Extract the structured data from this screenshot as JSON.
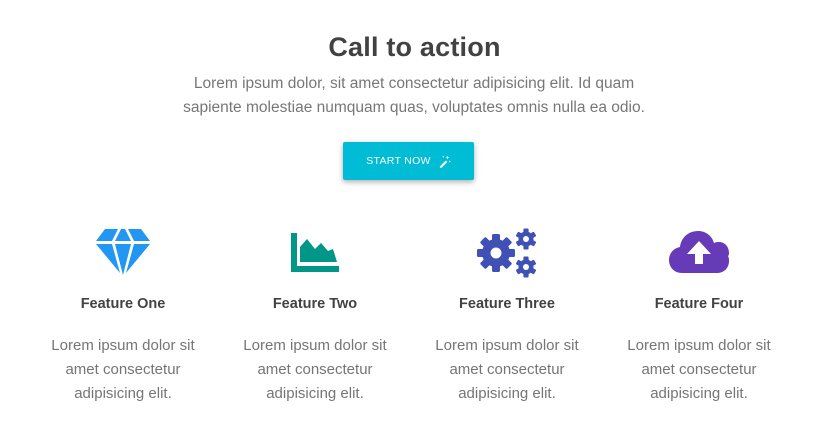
{
  "cta": {
    "title": "Call to action",
    "description": "Lorem ipsum dolor, sit amet consectetur adipisicing elit. Id quam sapiente molestiae numquam quas, voluptates omnis nulla ea odio.",
    "button_label": "START NOW",
    "button_icon": "magic-wand-icon",
    "button_color": "#00bcd4"
  },
  "features": [
    {
      "icon": "diamond-icon",
      "icon_color": "#2196f3",
      "title": "Feature One",
      "text": "Lorem ipsum dolor sit amet consectetur adipisicing elit."
    },
    {
      "icon": "area-chart-icon",
      "icon_color": "#009688",
      "title": "Feature Two",
      "text": "Lorem ipsum dolor sit amet consectetur adipisicing elit."
    },
    {
      "icon": "gears-icon",
      "icon_color": "#3f51b5",
      "title": "Feature Three",
      "text": "Lorem ipsum dolor sit amet consectetur adipisicing elit."
    },
    {
      "icon": "cloud-upload-icon",
      "icon_color": "#673ab7",
      "title": "Feature Four",
      "text": "Lorem ipsum dolor sit amet consectetur adipisicing elit."
    }
  ]
}
